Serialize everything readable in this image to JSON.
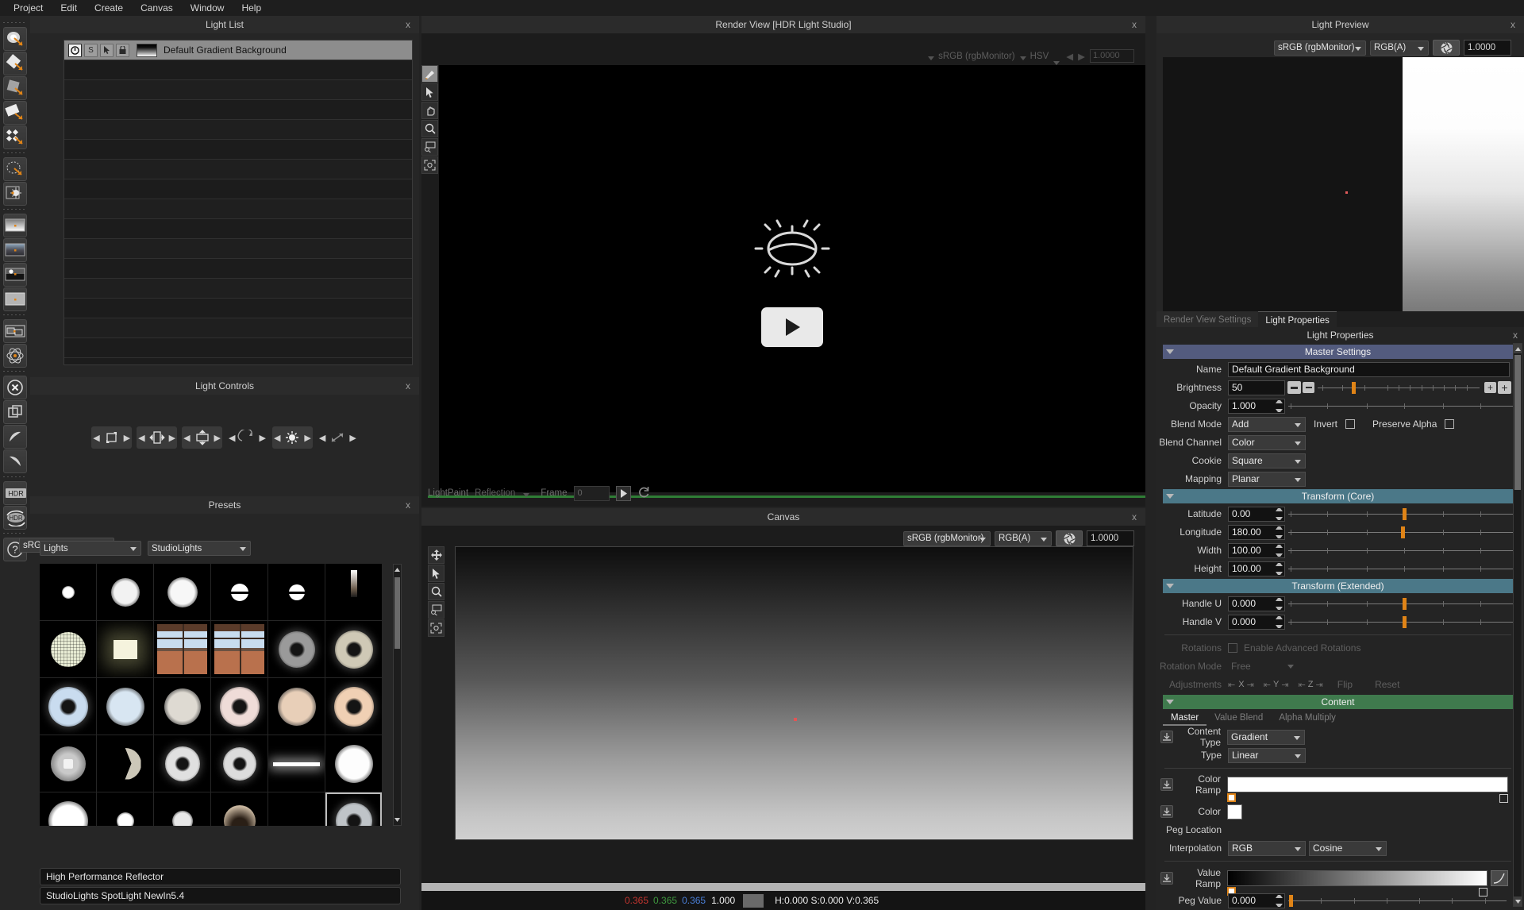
{
  "menubar": {
    "items": [
      "Project",
      "Edit",
      "Create",
      "Canvas",
      "Window",
      "Help"
    ]
  },
  "left_toolbar": {
    "items": [
      {
        "name": "light-area-icon"
      },
      {
        "name": "light-quad-icon"
      },
      {
        "name": "light-soft-icon"
      },
      {
        "name": "light-panel-icon"
      },
      {
        "name": "light-grid-icon"
      },
      {
        "name": "light-disc-icon"
      },
      {
        "name": "light-flag-icon"
      },
      {
        "name": "gradient-background-icon"
      },
      {
        "name": "hdri-background-icon"
      },
      {
        "name": "horizon-background-icon"
      },
      {
        "name": "flat-background-icon"
      },
      {
        "name": "copy-layers-icon"
      },
      {
        "name": "atom-procedural-icon"
      },
      {
        "name": "delete-light-icon"
      },
      {
        "name": "duplicate-icon"
      },
      {
        "name": "undo-icon"
      },
      {
        "name": "redo-icon"
      },
      {
        "name": "hdr-save-icon"
      },
      {
        "name": "hdr-reload-icon"
      },
      {
        "name": "help-icon"
      }
    ]
  },
  "light_list": {
    "title": "Light List",
    "close": "x",
    "selected_row": {
      "name": "Default Gradient Background",
      "toggles": [
        "power",
        "solo",
        "select",
        "lock"
      ]
    },
    "empty_rows": 14
  },
  "light_controls": {
    "title": "Light Controls",
    "close": "x",
    "buttons": [
      {
        "name": "scale-both-control",
        "enabled": true
      },
      {
        "name": "scale-width-control",
        "enabled": true
      },
      {
        "name": "scale-height-control",
        "enabled": true
      },
      {
        "name": "rotate-control",
        "enabled": false
      },
      {
        "name": "brightness-control",
        "enabled": true
      },
      {
        "name": "diagonal-control",
        "enabled": false
      }
    ]
  },
  "presets": {
    "title": "Presets",
    "close": "x",
    "colorspace": "sRGB (rgbMonitor)",
    "category": "Lights",
    "subcategory": "StudioLights",
    "selected_name": "High Performance Reflector",
    "selected_path": "StudioLights SpotLight NewIn5.4",
    "thumbnails": [
      {
        "id": "t1",
        "kind": "small-round",
        "tint": "#ffffff",
        "size": 16
      },
      {
        "id": "t2",
        "kind": "textured-round",
        "tint": "#f2f2f2",
        "size": 36
      },
      {
        "id": "t3",
        "kind": "soft-round",
        "tint": "#f7f7f7",
        "size": 38
      },
      {
        "id": "t4",
        "kind": "bar-round",
        "tint": "#ffffff",
        "size": 22
      },
      {
        "id": "t5",
        "kind": "bar-round",
        "tint": "#ffffff",
        "size": 20
      },
      {
        "id": "t6",
        "kind": "vertical-strip",
        "tint": "#ffffff",
        "size": 10
      },
      {
        "id": "t7",
        "kind": "mesh-round",
        "tint": "#e8ecd4",
        "size": 44
      },
      {
        "id": "t8",
        "kind": "soft-square",
        "tint": "#f5f3dd",
        "size": 30
      },
      {
        "id": "t9",
        "kind": "window-photo",
        "tint": "#a9c2d8",
        "size": 0
      },
      {
        "id": "t10",
        "kind": "window-photo2",
        "tint": "#b6c6d4",
        "size": 0
      },
      {
        "id": "t11",
        "kind": "ring-dark",
        "tint": "#9a9a9a",
        "size": 46
      },
      {
        "id": "t12",
        "kind": "ring-dark2",
        "tint": "#cfc9b6",
        "size": 48
      },
      {
        "id": "t13",
        "kind": "reflector-blue",
        "tint": "#c9dcef",
        "size": 50
      },
      {
        "id": "t14",
        "kind": "soft-blue",
        "tint": "#d8e6f2",
        "size": 48
      },
      {
        "id": "t15",
        "kind": "soft-grey",
        "tint": "#dedad2",
        "size": 46
      },
      {
        "id": "t16",
        "kind": "reflector-pink",
        "tint": "#efdcd8",
        "size": 50
      },
      {
        "id": "t17",
        "kind": "soft-peach",
        "tint": "#e8cfb8",
        "size": 48
      },
      {
        "id": "t18",
        "kind": "reflector-peach",
        "tint": "#f0d0b4",
        "size": 50
      },
      {
        "id": "t19",
        "kind": "fixture-grey",
        "tint": "#c9c9c9",
        "size": 44
      },
      {
        "id": "t20",
        "kind": "crescent",
        "tint": "#f0ead8",
        "size": 40
      },
      {
        "id": "t21",
        "kind": "ring-thin",
        "tint": "#e0e0e0",
        "size": 44
      },
      {
        "id": "t22",
        "kind": "ring-thin2",
        "tint": "#dcdcdc",
        "size": 42
      },
      {
        "id": "t23",
        "kind": "bar-white",
        "tint": "#ffffff",
        "size": 0
      },
      {
        "id": "t24",
        "kind": "plain-round",
        "tint": "#fdfdfd",
        "size": 48
      },
      {
        "id": "t25",
        "kind": "plain-round",
        "tint": "#ffffff",
        "size": 50
      },
      {
        "id": "t26",
        "kind": "glow-small",
        "tint": "#ffffff",
        "size": 22
      },
      {
        "id": "t27",
        "kind": "glow-wide",
        "tint": "#e8e8e8",
        "size": 26
      },
      {
        "id": "t28",
        "kind": "dome-dark",
        "tint": "#cbb9a2",
        "size": 40
      },
      {
        "id": "t29",
        "kind": "fresnel",
        "tint": "#e9e6c0",
        "size": 42
      },
      {
        "id": "t30",
        "kind": "reflector-ring",
        "tint": "#bfc4c8",
        "size": 46
      },
      {
        "id": "t31",
        "kind": "partial-a",
        "tint": "#bdbdbd",
        "size": 30
      },
      {
        "id": "t32",
        "kind": "partial-b",
        "tint": "#8f8f8f",
        "size": 30
      },
      {
        "id": "t33",
        "kind": "partial-c",
        "tint": "#d0d0d0",
        "size": 30
      },
      {
        "id": "t34",
        "kind": "partial-d",
        "tint": "#caa",
        "size": 30
      },
      {
        "id": "t35",
        "kind": "partial-e",
        "tint": "#c0a090",
        "size": 30
      },
      {
        "id": "t36",
        "kind": "partial-f",
        "tint": "#b06060",
        "size": 30
      }
    ]
  },
  "render_view": {
    "title": "Render View [HDR Light Studio]",
    "close": "x",
    "colorspace": "sRGB (rgbMonitor)",
    "channel": "HSV",
    "exposure": "1.0000",
    "placeholder_icon": "sun-icon",
    "play_icon": "play-icon",
    "lightpaint_label": "LightPaint",
    "lightpaint_mode": "Reflection",
    "frame_label": "Frame",
    "frame_value": "0",
    "play_button": "play-icon",
    "refresh_button": "refresh-icon",
    "tools": [
      "brush-icon",
      "pointer-icon",
      "pan-icon",
      "zoom-icon",
      "fit-screen-icon",
      "fit-window-icon"
    ]
  },
  "canvas": {
    "title": "Canvas",
    "close": "x",
    "colorspace": "sRGB (rgbMonitor)",
    "channel": "RGB(A)",
    "exposure": "1.0000",
    "tools": [
      "move-icon",
      "pointer-icon",
      "zoom-icon",
      "fit-screen-icon",
      "fit-window-icon"
    ],
    "status": {
      "r": "0.365",
      "g": "0.365",
      "b": "0.365",
      "a": "1.000",
      "hsv": "H:0.000 S:0.000 V:0.365"
    }
  },
  "light_preview": {
    "title": "Light Preview",
    "close": "x",
    "colorspace": "sRGB (rgbMonitor)",
    "channel": "RGB(A)",
    "aperture_icon": "aperture-icon",
    "exposure": "1.0000"
  },
  "light_properties": {
    "tabs": [
      {
        "label": "Render View Settings",
        "active": false
      },
      {
        "label": "Light Properties",
        "active": true
      }
    ],
    "header": "Light Properties",
    "close": "x",
    "master_settings": {
      "section": "Master Settings",
      "name_label": "Name",
      "name_value": "Default Gradient Background",
      "brightness_label": "Brightness",
      "brightness_value": "50",
      "brightness_knob_pct": 22,
      "opacity_label": "Opacity",
      "opacity_value": "1.000",
      "opacity_knob_pct": 100,
      "blend_mode_label": "Blend Mode",
      "blend_mode_value": "Add",
      "invert_label": "Invert",
      "invert_checked": false,
      "preserve_alpha_label": "Preserve Alpha",
      "preserve_alpha_checked": false,
      "blend_channel_label": "Blend Channel",
      "blend_channel_value": "Color",
      "cookie_label": "Cookie",
      "cookie_value": "Square",
      "mapping_label": "Mapping",
      "mapping_value": "Planar"
    },
    "transform_core": {
      "section": "Transform (Core)",
      "rows": [
        {
          "label": "Latitude",
          "value": "0.00",
          "knob_pct": 50
        },
        {
          "label": "Longitude",
          "value": "180.00",
          "knob_pct": 49.5
        },
        {
          "label": "Width",
          "value": "100.00",
          "knob_pct": 99
        },
        {
          "label": "Height",
          "value": "100.00",
          "knob_pct": 99
        }
      ]
    },
    "transform_extended": {
      "section": "Transform (Extended)",
      "rows": [
        {
          "label": "Handle U",
          "value": "0.000",
          "knob_pct": 50
        },
        {
          "label": "Handle V",
          "value": "0.000",
          "knob_pct": 50
        }
      ],
      "rotations_label": "Rotations",
      "advanced_rotations_label": "Enable Advanced Rotations",
      "advanced_rotations_checked": false,
      "rotation_mode_label": "Rotation Mode",
      "rotation_mode_value": "Free",
      "adjustments_label": "Adjustments",
      "axis_x": "X",
      "axis_y": "Y",
      "axis_z": "Z",
      "flip_label": "Flip",
      "reset_label": "Reset"
    },
    "content": {
      "section": "Content",
      "tabs": [
        {
          "label": "Master",
          "active": true
        },
        {
          "label": "Value Blend",
          "active": false
        },
        {
          "label": "Alpha Multiply",
          "active": false
        }
      ],
      "content_type_label": "Content Type",
      "content_type_value": "Gradient",
      "type_label": "Type",
      "type_value": "Linear",
      "color_ramp_label": "Color Ramp",
      "color_label": "Color",
      "color_value": "#ffffff",
      "peg_location_label": "Peg Location",
      "interpolation_label": "Interpolation",
      "interpolation_space": "RGB",
      "interpolation_curve": "Cosine",
      "value_ramp_label": "Value Ramp",
      "peg_value_label": "Peg Value",
      "peg_value": "0.000",
      "peg_value_knob_pct": 1
    }
  },
  "colors": {
    "accent_orange": "#e08417",
    "section_blue": "#535b7e",
    "section_teal": "#4b7888",
    "section_green": "#3f7a4d",
    "panel_bg": "#262626",
    "render_green_bar": "#2f7d35"
  }
}
